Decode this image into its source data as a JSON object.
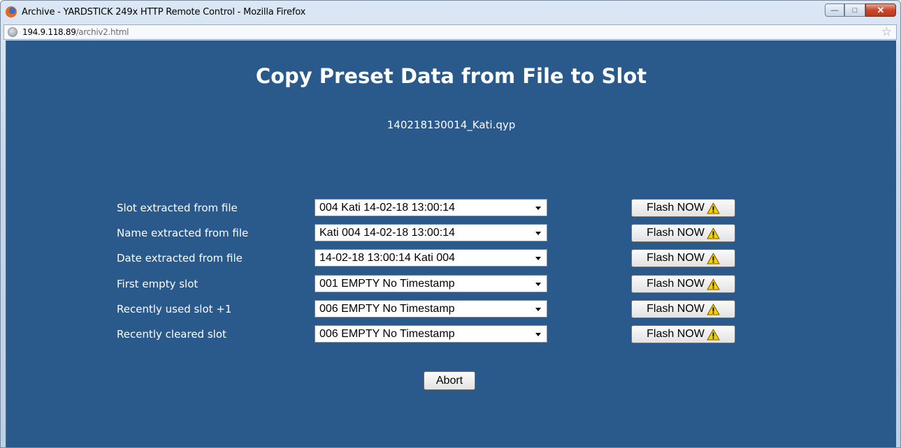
{
  "window": {
    "title": "Archive - YARDSTICK 249x HTTP Remote Control - Mozilla Firefox",
    "controls": {
      "minimize": "—",
      "maximize": "□",
      "close": "✕"
    }
  },
  "address_bar": {
    "host": "194.9.118.89",
    "path": "/archiv2.html"
  },
  "page": {
    "title": "Copy Preset Data from File to Slot",
    "filename": "140218130014_Kati.qyp",
    "rows": [
      {
        "label": "Slot extracted from file",
        "selected": "004 Kati 14-02-18 13:00:14",
        "button": "Flash NOW"
      },
      {
        "label": "Name extracted from file",
        "selected": "Kati 004 14-02-18 13:00:14",
        "button": "Flash NOW"
      },
      {
        "label": "Date extracted from file",
        "selected": "14-02-18 13:00:14 Kati 004",
        "button": "Flash NOW"
      },
      {
        "label": "First empty slot",
        "selected": "001 EMPTY No Timestamp",
        "button": "Flash NOW"
      },
      {
        "label": "Recently used slot +1",
        "selected": "006 EMPTY No Timestamp",
        "button": "Flash NOW"
      },
      {
        "label": "Recently cleared slot",
        "selected": "006 EMPTY No Timestamp",
        "button": "Flash NOW"
      }
    ],
    "abort_label": "Abort"
  },
  "colors": {
    "page_background": "#295a8b",
    "text": "#ffffff",
    "warning_icon": "#f5d000"
  }
}
